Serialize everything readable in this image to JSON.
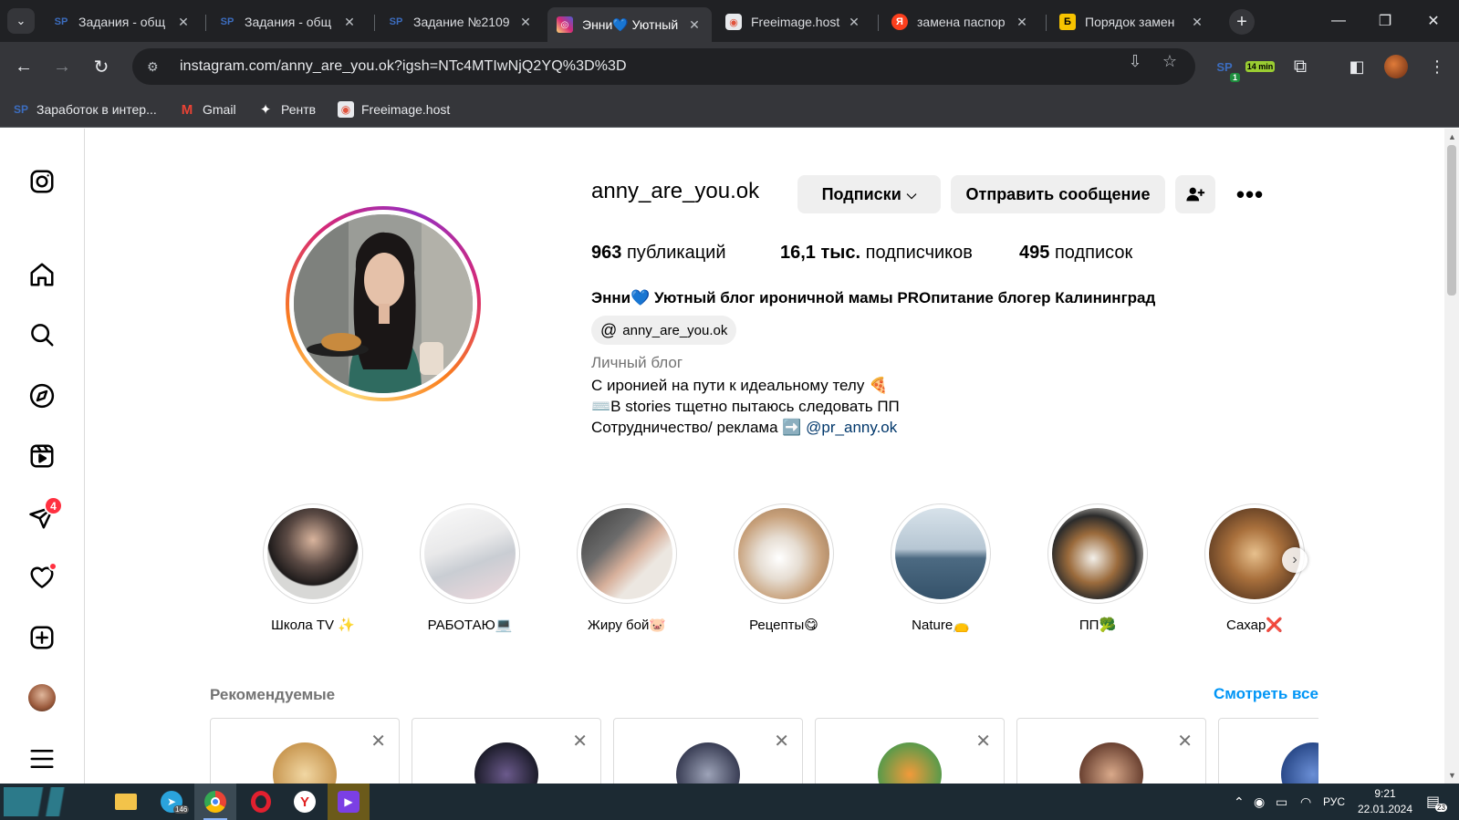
{
  "browser": {
    "tabs": [
      {
        "title": "Задания - общ",
        "favicon": "SP",
        "color": "#3c6dbf"
      },
      {
        "title": "Задания - общ",
        "favicon": "SP",
        "color": "#3c6dbf"
      },
      {
        "title": "Задание №2109",
        "favicon": "SP",
        "color": "#3c6dbf"
      },
      {
        "title": "Энни💙 Уютный",
        "favicon": "instagram",
        "color": "#e1306c"
      },
      {
        "title": "Freeimage.host",
        "favicon": "freeimage",
        "color": "#e8eaed"
      },
      {
        "title": "замена паспор",
        "favicon": "Я",
        "color": "#fc3f1d"
      },
      {
        "title": "Порядок замен",
        "favicon": "Б",
        "color": "#f7c300"
      }
    ],
    "active_tab_index": 3,
    "url": "instagram.com/anny_are_you.ok?igsh=NTc4MTIwNjQ2YQ%3D%3D",
    "extensions": {
      "sp_badge": "1",
      "timer_label": "14 min"
    },
    "bookmarks": [
      {
        "label": "Заработок в интер...",
        "icon": "sp-icon"
      },
      {
        "label": "Gmail",
        "icon": "gmail-icon"
      },
      {
        "label": "Рентв",
        "icon": "rentv-icon"
      },
      {
        "label": "Freeimage.host",
        "icon": "freeimage-icon"
      }
    ]
  },
  "sidebar": {
    "messages_badge": "4"
  },
  "profile": {
    "username": "anny_are_you.ok",
    "following_button": "Подписки",
    "message_button": "Отправить сообщение",
    "stats": {
      "posts_count": "963",
      "posts_label": "публикаций",
      "followers_count": "16,1 тыс.",
      "followers_label": "подписчиков",
      "following_count": "495",
      "following_label": "подписок"
    },
    "full_name": "Энни💙 Уютный блог ироничной мамы PROпитание блогер Калининград",
    "threads_handle": "anny_are_you.ok",
    "category": "Личный блог",
    "bio_lines": [
      "С иронией на пути к идеальному телу 🍕",
      "⌨️В stories тщетно пытаюсь следовать ПП",
      "Сотрудничество/ реклама ➡️ "
    ],
    "bio_link": "@pr_anny.ok"
  },
  "highlights": [
    {
      "label": "Школа TV ✨"
    },
    {
      "label": "РАБОТАЮ💻"
    },
    {
      "label": "Жиру бой🐷"
    },
    {
      "label": "Рецепты😋"
    },
    {
      "label": "Nature👝"
    },
    {
      "label": "ПП🥦"
    },
    {
      "label": "Сахар❌"
    }
  ],
  "suggestions": {
    "title": "Рекомендуемые",
    "see_all": "Смотреть все"
  },
  "taskbar": {
    "telegram_badge": "146",
    "lang": "РУС",
    "time": "9:21",
    "date": "22.01.2024",
    "notifications": "23"
  }
}
